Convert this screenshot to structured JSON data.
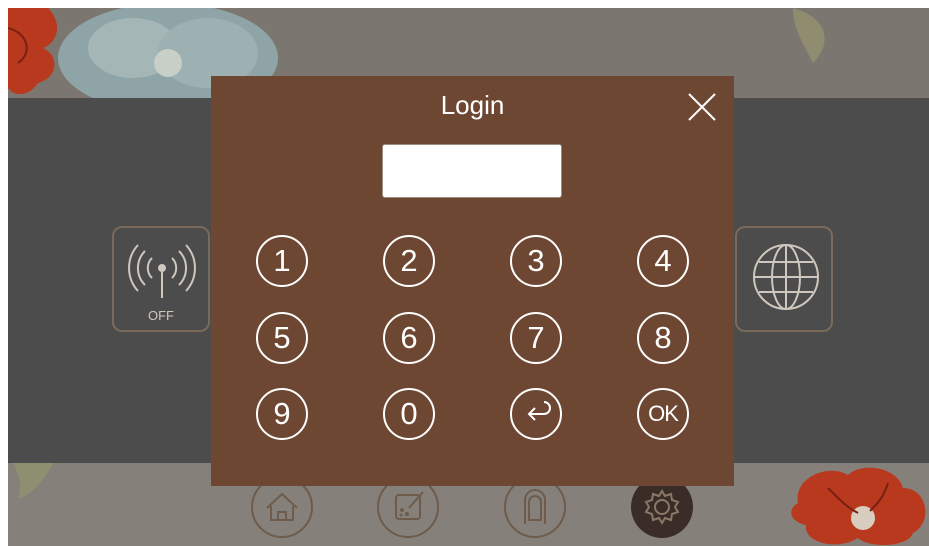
{
  "background": {
    "left_tile_status": "OFF"
  },
  "login_dialog": {
    "title": "Login",
    "password_value": "",
    "keys": [
      {
        "label": "1",
        "name": "key-1"
      },
      {
        "label": "2",
        "name": "key-2"
      },
      {
        "label": "3",
        "name": "key-3"
      },
      {
        "label": "4",
        "name": "key-4"
      },
      {
        "label": "5",
        "name": "key-5"
      },
      {
        "label": "6",
        "name": "key-6"
      },
      {
        "label": "7",
        "name": "key-7"
      },
      {
        "label": "8",
        "name": "key-8"
      },
      {
        "label": "9",
        "name": "key-9"
      },
      {
        "label": "0",
        "name": "key-0"
      },
      {
        "label": "",
        "name": "backspace-key",
        "icon": "back-arrow-icon"
      },
      {
        "label": "OK",
        "name": "ok-key"
      }
    ]
  },
  "bottom_nav": [
    {
      "icon": "home-icon"
    },
    {
      "icon": "edit-icon"
    },
    {
      "icon": "door-icon"
    },
    {
      "icon": "gear-icon",
      "active": true
    }
  ],
  "colors": {
    "dialog_background": "#6e4733",
    "overlay": "#4c4c4c",
    "accent_flower": "#b8391e"
  }
}
